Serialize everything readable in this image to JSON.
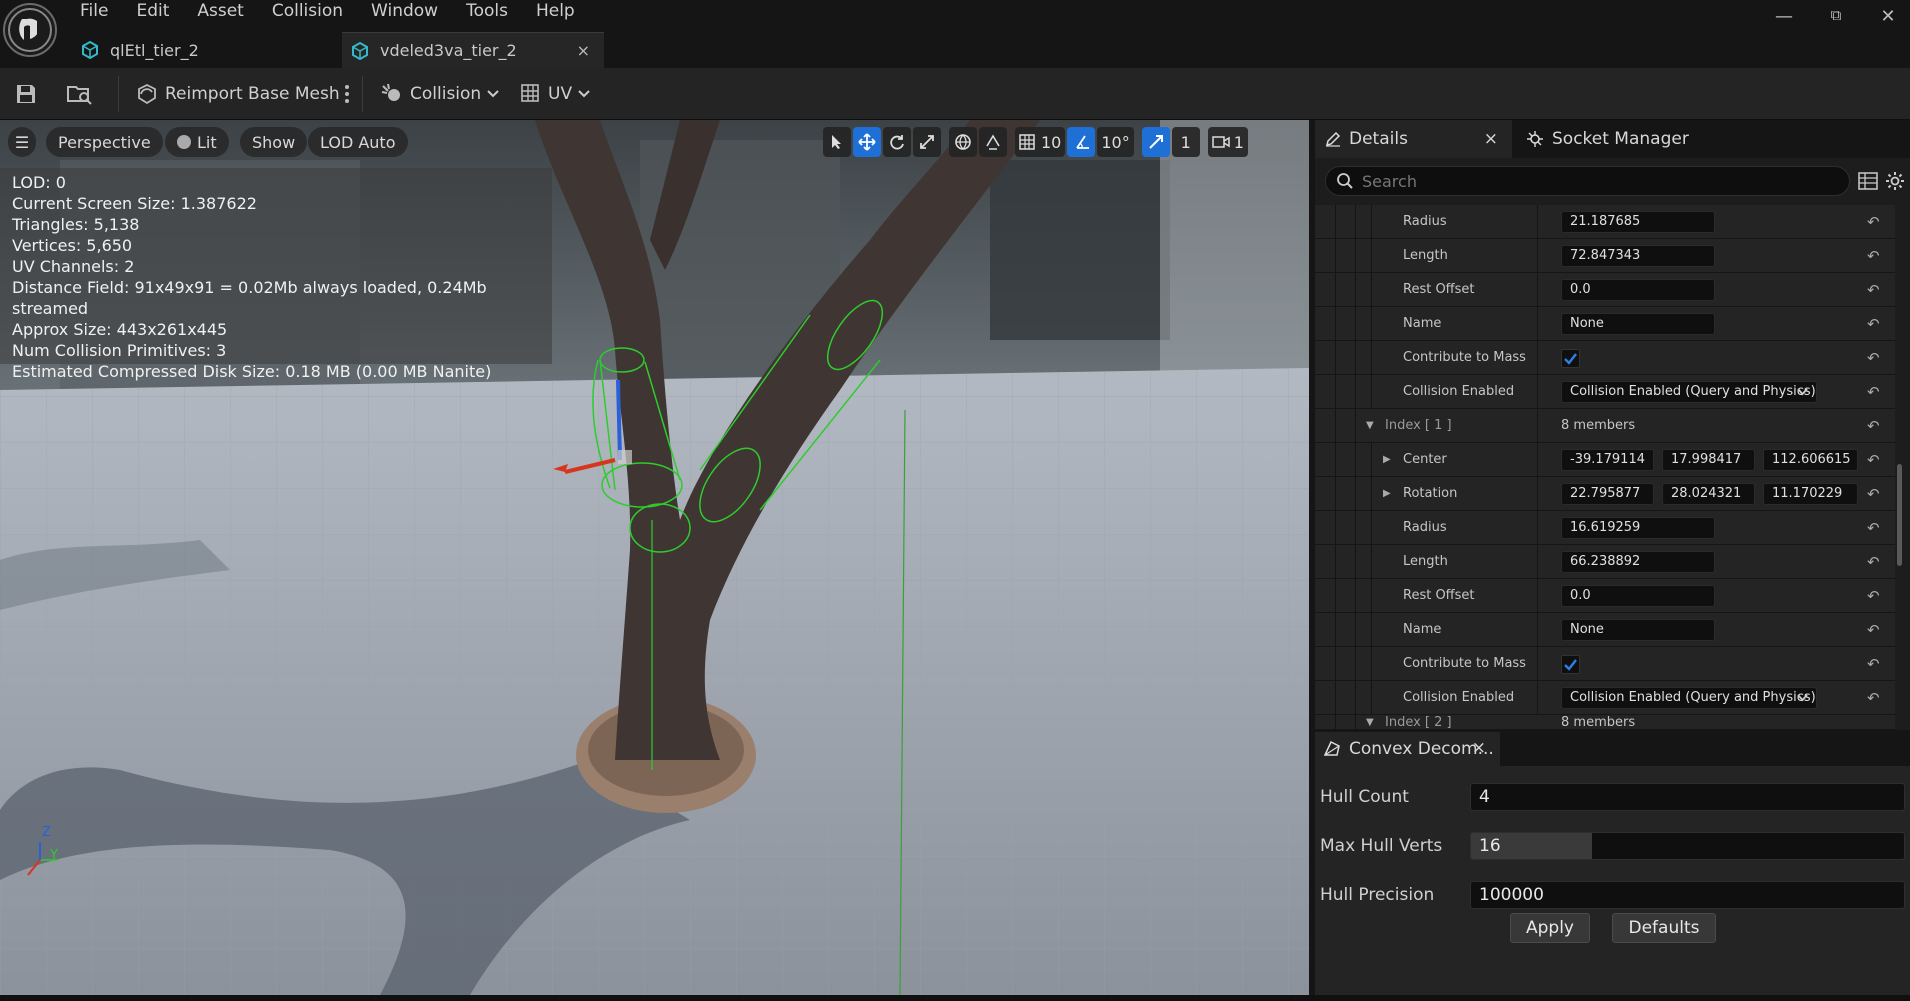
{
  "menu": [
    "File",
    "Edit",
    "Asset",
    "Collision",
    "Window",
    "Tools",
    "Help"
  ],
  "tabs": [
    {
      "label": "qlEtl_tier_2"
    },
    {
      "label": "vdeled3va_tier_2"
    }
  ],
  "window_controls": {
    "minimize": "—",
    "maximize": "⧉",
    "close": "✕"
  },
  "toolbar": {
    "reimport_label": "Reimport Base Mesh",
    "collision_label": "Collision",
    "uv_label": "UV"
  },
  "viewport": {
    "buttons": {
      "menu": "☰",
      "perspective": "Perspective",
      "lit": "Lit",
      "show": "Show",
      "lod": "LOD Auto"
    },
    "stats": [
      "LOD:  0",
      "Current Screen Size:  1.387622",
      "Triangles:  5,138",
      "Vertices:  5,650",
      "UV Channels:  2",
      "Distance Field:  91x49x91 = 0.02Mb always loaded, 0.24Mb streamed",
      "Approx Size: 443x261x445",
      "Num Collision Primitives:  3",
      "Estimated Compressed Disk Size: 0.18 MB (0.00 MB Nanite)"
    ],
    "grid_snap": "10",
    "rotation_snap": "10°",
    "scale_snap": "1",
    "camera_speed": "1",
    "axis": {
      "z": "Z",
      "y": "Y"
    }
  },
  "details": {
    "tab_label": "Details",
    "tab_close": "×",
    "socket_tab_label": "Socket Manager",
    "search_placeholder": "Search",
    "rows": [
      {
        "label": "Radius",
        "value": "21.187685"
      },
      {
        "label": "Length",
        "value": "72.847343"
      },
      {
        "label": "Rest Offset",
        "value": "0.0"
      },
      {
        "label": "Name",
        "value": "None"
      },
      {
        "label": "Contribute to Mass",
        "checked": true
      },
      {
        "label": "Collision Enabled",
        "value": "Collision Enabled (Query and Physics)"
      },
      {
        "label": "Index [ 1 ]",
        "value": "8 members"
      },
      {
        "label": "Center",
        "values": [
          "-39.179114",
          "17.998417",
          "112.606615"
        ]
      },
      {
        "label": "Rotation",
        "values": [
          "22.795877",
          "28.024321",
          "11.170229"
        ]
      },
      {
        "label": "Radius",
        "value": "16.619259"
      },
      {
        "label": "Length",
        "value": "66.238892"
      },
      {
        "label": "Rest Offset",
        "value": "0.0"
      },
      {
        "label": "Name",
        "value": "None"
      },
      {
        "label": "Contribute to Mass",
        "checked": true
      },
      {
        "label": "Collision Enabled",
        "value": "Collision Enabled (Query and Physics)"
      },
      {
        "label": "Index [ 2 ]",
        "value": "8 members"
      }
    ]
  },
  "convex": {
    "tab_label": "Convex Decom...",
    "tab_close": "×",
    "hull_count_label": "Hull Count",
    "hull_count": "4",
    "max_hull_verts_label": "Max Hull Verts",
    "max_hull_verts": "16",
    "max_hull_verts_fill": 0.28,
    "hull_precision_label": "Hull Precision",
    "hull_precision": "100000",
    "apply_label": "Apply",
    "defaults_label": "Defaults"
  },
  "colors": {
    "accent": "#1e6fd6",
    "collision": "#2ecc2e",
    "panel": "#242424"
  }
}
